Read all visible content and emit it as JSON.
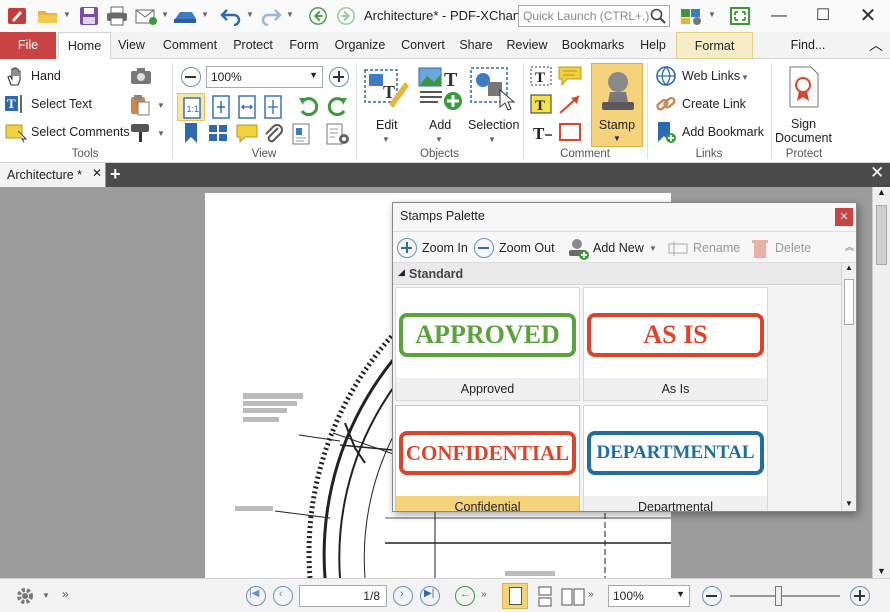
{
  "window": {
    "title": "Architecture* - PDF-XChan...",
    "quick_launch_placeholder": "Quick Launch (CTRL+.)"
  },
  "menu": {
    "file": "File",
    "home": "Home",
    "view": "View",
    "comment": "Comment",
    "protect": "Protect",
    "form": "Form",
    "organize": "Organize",
    "convert": "Convert",
    "share": "Share",
    "review": "Review",
    "bookmarks": "Bookmarks",
    "help": "Help",
    "format": "Format",
    "find": "Find..."
  },
  "ribbon": {
    "tools": {
      "hand": "Hand",
      "select_text": "Select Text",
      "select_comments": "Select Comments",
      "label": "Tools"
    },
    "view": {
      "zoom_value": "100%",
      "label": "View"
    },
    "objects": {
      "edit": "Edit",
      "add": "Add",
      "selection": "Selection",
      "label": "Objects"
    },
    "comment": {
      "stamp": "Stamp",
      "label": "Comment"
    },
    "links": {
      "web_links": "Web Links",
      "create_link": "Create Link",
      "add_bookmark": "Add Bookmark",
      "label": "Links"
    },
    "protect": {
      "sign_document_1": "Sign",
      "sign_document_2": "Document",
      "label": "Protect"
    }
  },
  "doc_tab": {
    "name": "Architecture *"
  },
  "palette": {
    "title": "Stamps Palette",
    "toolbar": {
      "zoom_in": "Zoom In",
      "zoom_out": "Zoom Out",
      "add_new": "Add New",
      "rename": "Rename",
      "delete": "Delete"
    },
    "section": "Standard",
    "stamps": [
      {
        "text": "APPROVED",
        "caption": "Approved",
        "color": "#5aa33c"
      },
      {
        "text": "AS IS",
        "caption": "As Is",
        "color": "#d9442a"
      },
      {
        "text": "CONFIDENTIAL",
        "caption": "Confidential",
        "color": "#d9442a"
      },
      {
        "text": "DEPARTMENTAL",
        "caption": "Departmental",
        "color": "#1f6ea0"
      }
    ]
  },
  "statusbar": {
    "page": "1",
    "page_total": "/8",
    "zoom": "100%"
  },
  "colors": {
    "accent": "#c94343",
    "format_tab": "#f6ecc7",
    "stamp_active": "#f5d37a"
  }
}
